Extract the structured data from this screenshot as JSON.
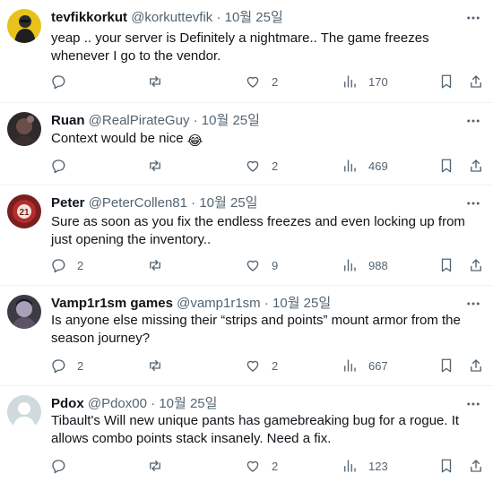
{
  "tweets": [
    {
      "name": "tevfikkorkut",
      "handle": "@korkuttevfik",
      "dot": "·",
      "time": "10월 25일",
      "text": "yeap .. your server is Definitely a nightmare.. The game freezes whenever I go to the vendor.",
      "replies": "",
      "likes": "2",
      "views": "170"
    },
    {
      "name": "Ruan",
      "handle": "@RealPirateGuy",
      "dot": "·",
      "time": "10월 25일",
      "text": "Context would be nice",
      "emoji": "😂",
      "replies": "",
      "likes": "2",
      "views": "469"
    },
    {
      "name": "Peter",
      "handle": "@PeterCollen81",
      "dot": "·",
      "time": "10월 25일",
      "text": "Sure as soon as you fix the endless freezes and even locking up from just opening the inventory..",
      "replies": "2",
      "likes": "9",
      "views": "988"
    },
    {
      "name": "Vamp1r1sm games",
      "handle": "@vamp1r1sm",
      "dot": "·",
      "time": "10월 25일",
      "text": "Is anyone else missing their “strips and points” mount armor from the season journey?",
      "replies": "2",
      "likes": "2",
      "views": "667"
    },
    {
      "name": "Pdox",
      "handle": "@Pdox00",
      "dot": "·",
      "time": "10월 25일",
      "text": "Tibault's Will new unique pants has gamebreaking bug for a rogue. It allows combo points stack insanely. Need a fix.",
      "replies": "",
      "likes": "2",
      "views": "123"
    }
  ]
}
